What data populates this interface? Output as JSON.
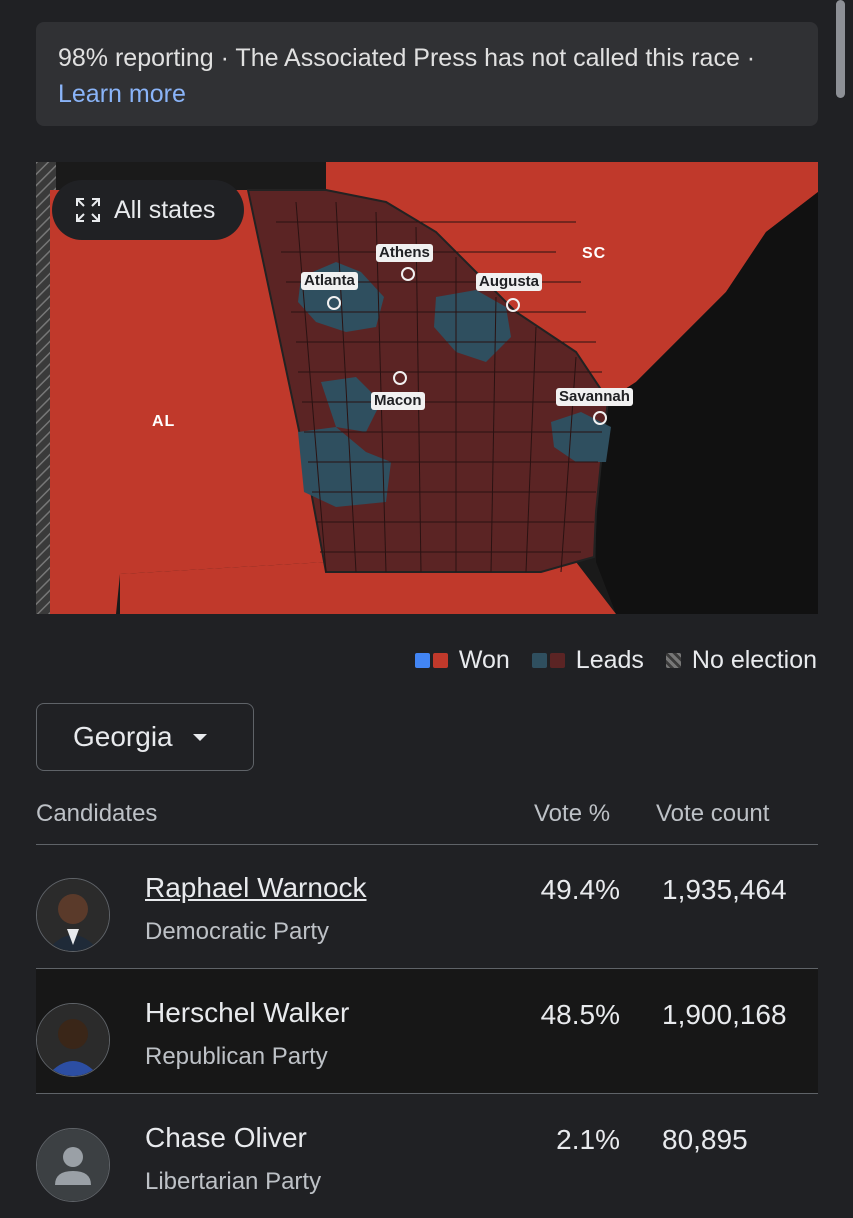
{
  "banner": {
    "status": "98% reporting · The Associated Press has not called this race ·",
    "link": "Learn more"
  },
  "map": {
    "all_states_label": "All states",
    "state_labels": {
      "al": "AL",
      "sc": "SC"
    },
    "cities": [
      "Athens",
      "Atlanta",
      "Augusta",
      "Macon",
      "Savannah"
    ],
    "colors": {
      "rep_won": "#c0392b",
      "rep_leads": "#5b2424",
      "dem_leads": "#2f4f5f",
      "dem_won": "#4285f4"
    }
  },
  "legend": {
    "won": "Won",
    "leads": "Leads",
    "no_election": "No election"
  },
  "state_select": {
    "value": "Georgia"
  },
  "table": {
    "headers": {
      "candidates": "Candidates",
      "vote_pct": "Vote %",
      "vote_count": "Vote count"
    },
    "rows": [
      {
        "name": "Raphael Warnock",
        "party": "Democratic Party",
        "pct": "49.4%",
        "count": "1,935,464"
      },
      {
        "name": "Herschel Walker",
        "party": "Republican Party",
        "pct": "48.5%",
        "count": "1,900,168"
      },
      {
        "name": "Chase Oliver",
        "party": "Libertarian Party",
        "pct": "2.1%",
        "count": "80,895"
      }
    ]
  }
}
